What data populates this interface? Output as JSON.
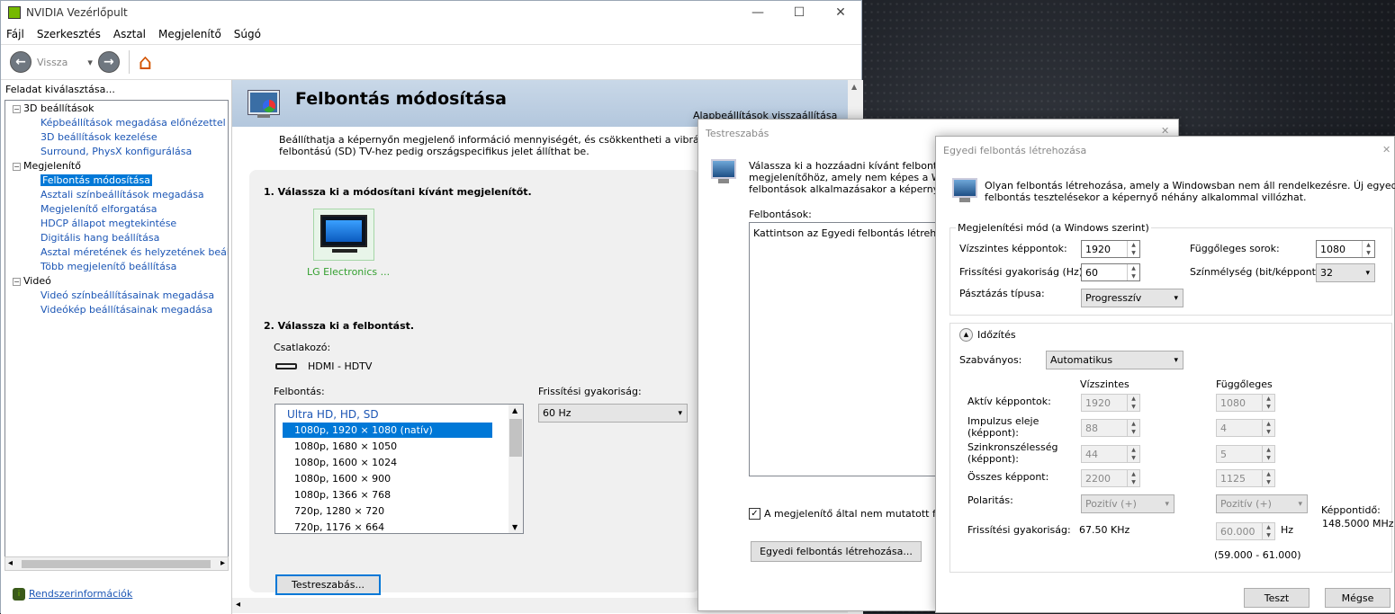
{
  "desktop": {
    "bg": "#1d2026"
  },
  "window": {
    "title": "NVIDIA Vezérlőpult",
    "min": "—",
    "max": "☐",
    "close": "✕"
  },
  "menu": [
    "Fájl",
    "Szerkesztés",
    "Asztal",
    "Megjelenítő",
    "Súgó"
  ],
  "toolbar": {
    "back": "Vissza",
    "back_glyph": "←",
    "fwd_glyph": "→",
    "dd": "▾",
    "home_glyph": "⌂"
  },
  "task": {
    "header": "Feladat kiválasztása...",
    "tree": [
      {
        "label": "3D beállítások",
        "level": 0,
        "exp": "−"
      },
      {
        "label": "Képbeállítások megadása előnézettel",
        "level": 1
      },
      {
        "label": "3D beállítások kezelése",
        "level": 1
      },
      {
        "label": "Surround, PhysX konfigurálása",
        "level": 1
      },
      {
        "label": "Megjelenítő",
        "level": 0,
        "exp": "−"
      },
      {
        "label": "Felbontás módosítása",
        "level": 1,
        "selected": true
      },
      {
        "label": "Asztali színbeállítások megadása",
        "level": 1
      },
      {
        "label": "Megjelenítő elforgatása",
        "level": 1
      },
      {
        "label": "HDCP állapot megtekintése",
        "level": 1
      },
      {
        "label": "Digitális hang beállítása",
        "level": 1
      },
      {
        "label": "Asztal méretének és helyzetének beállítása",
        "level": 1
      },
      {
        "label": "Több megjelenítő beállítása",
        "level": 1
      },
      {
        "label": "Videó",
        "level": 0,
        "exp": "−"
      },
      {
        "label": "Videó színbeállításainak megadása",
        "level": 1
      },
      {
        "label": "Videókép beállításainak megadása",
        "level": 1
      }
    ],
    "sysinfo": "Rendszerinformációk",
    "scroll_left": "◂",
    "scroll_right": "▸"
  },
  "main": {
    "title": "Felbontás módosítása",
    "restore": "Alapbeállítások visszaállítása",
    "desc1": "Beállíthatja a képernyőn megjelenő információ mennyiségét, és csökkentheti a vibrálást. Ha HDT",
    "desc2": "felbontású (SD) TV-hez pedig országspecifikus jelet állíthat be.",
    "step1": "1. Válassza ki a módosítani kívánt megjelenítőt.",
    "display_name": "LG Electronics ...",
    "step2": "2. Válassza ki a felbontást.",
    "connector_label": "Csatlakozó:",
    "connector": "HDMI - HDTV",
    "res_label": "Felbontás:",
    "refresh_label": "Frissítési gyakoriság:",
    "refresh_value": "60 Hz",
    "res_group": "Ultra HD, HD, SD",
    "resolutions": [
      "1080p, 1920 × 1080 (natív)",
      "1080p, 1680 × 1050",
      "1080p, 1600 × 1024",
      "1080p, 1600 × 900",
      "1080p, 1366 × 768",
      "720p, 1280 × 720",
      "720p, 1176 × 664"
    ],
    "customize": "Testreszabás...",
    "up": "▲",
    "down": "▼",
    "dd": "▾"
  },
  "dlg1": {
    "title": "Testreszabás",
    "close": "✕",
    "desc1": "Válassza ki a hozzáadni kívánt felbontásoka",
    "desc2": "megjelenítőhöz, amely nem képes a Window",
    "desc3": "felbontások alkalmazásakor a képernyő idei",
    "list_label": "Felbontások:",
    "list_item": "Kattintson az Egyedi felbontás létrehozása",
    "checkbox": "A megjelenítő által nem mutatott felbont",
    "check": "✓",
    "create": "Egyedi felbontás létrehozása..."
  },
  "dlg2": {
    "title": "Egyedi felbontás létrehozása",
    "close": "✕",
    "desc1": "Olyan felbontás létrehozása, amely a Windowsban nem áll rendelkezésre. Új egyedi",
    "desc2": "felbontás tesztelésekor a képernyő néhány alkalommal villózhat.",
    "mode_group": "Megjelenítési mód (a Windows szerint)",
    "hpix_label": "Vízszintes képpontok:",
    "hpix": "1920",
    "vlines_label": "Függőleges sorok:",
    "vlines": "1080",
    "refresh_label": "Frissítési gyakoriság (Hz):",
    "refresh": "60",
    "depth_label": "Színmélység (bit/képpont):",
    "depth": "32",
    "scan_label": "Pásztázás típusa:",
    "scan": "Progresszív",
    "timing": "Időzítés",
    "timing_glyph": "▲",
    "standard_label": "Szabványos:",
    "standard": "Automatikus",
    "col_h": "Vízszintes",
    "col_v": "Függőleges",
    "rows": [
      {
        "label": "Aktív képpontok:",
        "h": "1920",
        "v": "1080"
      },
      {
        "label": "Impulzus eleje\n(képpont):",
        "h": "88",
        "v": "4"
      },
      {
        "label": "Szinkronszélesség\n(képpont):",
        "h": "44",
        "v": "5"
      },
      {
        "label": "Összes képpont:",
        "h": "2200",
        "v": "1125"
      }
    ],
    "polarity_label": "Polaritás:",
    "pol_h": "Pozitív (+)",
    "pol_v": "Pozitív (+)",
    "pixclock_label": "Képpontidő:",
    "pixclock": "148.5000 MHz",
    "freq_label": "Frissítési gyakoriság:",
    "freq_h": "67.50 KHz",
    "freq_v": "60.000",
    "hz": "Hz",
    "range": "(59.000 - 61.000)",
    "test": "Teszt",
    "cancel": "Mégse"
  }
}
